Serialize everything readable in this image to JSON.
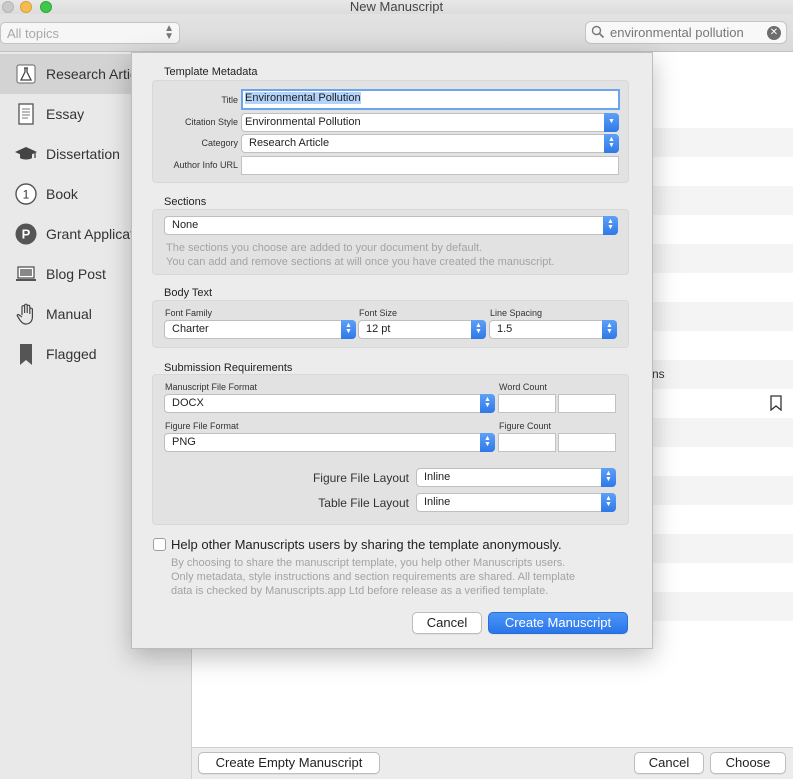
{
  "window": {
    "title": "New Manuscript"
  },
  "toolbar": {
    "topic_select": "All topics",
    "search_value": "environmental pollution"
  },
  "sidebar": {
    "items": [
      {
        "label": "Research Artic",
        "icon": "flask-icon",
        "selected": true
      },
      {
        "label": "Essay",
        "icon": "document-icon"
      },
      {
        "label": "Dissertation",
        "icon": "graduation-cap-icon"
      },
      {
        "label": "Book",
        "icon": "numbered-circle-icon",
        "icon_text": "1"
      },
      {
        "label": "Grant Applicat",
        "icon": "p-circle-icon",
        "icon_text": "P"
      },
      {
        "label": "Blog Post",
        "icon": "laptop-icon"
      },
      {
        "label": "Manual",
        "icon": "hand-icon"
      },
      {
        "label": "Flagged",
        "icon": "bookmark-icon"
      }
    ]
  },
  "main": {
    "partial_row_text": "ns"
  },
  "dialog": {
    "metadata": {
      "section_title": "Template Metadata",
      "title_label": "Title",
      "title_value": "Environmental Pollution",
      "citation_label": "Citation Style",
      "citation_value": "Environmental Pollution",
      "category_label": "Category",
      "category_value": "Research Article",
      "author_label": "Author Info URL",
      "author_value": ""
    },
    "sections": {
      "section_title": "Sections",
      "value": "None",
      "hint_line1": "The sections you choose are added to your document by default.",
      "hint_line2": "You can add and remove sections at will once you have created the manuscript."
    },
    "body_text": {
      "section_title": "Body Text",
      "font_family_label": "Font Family",
      "font_family_value": "Charter",
      "font_size_label": "Font Size",
      "font_size_value": "12 pt",
      "line_spacing_label": "Line Spacing",
      "line_spacing_value": "1.5"
    },
    "submission": {
      "section_title": "Submission Requirements",
      "manuscript_format_label": "Manuscript  File Format",
      "manuscript_format_value": "DOCX",
      "word_count_label": "Word Count",
      "figure_format_label": "Figure File Format",
      "figure_format_value": "PNG",
      "figure_count_label": "Figure Count",
      "figure_layout_label": "Figure File Layout",
      "figure_layout_value": "Inline",
      "table_layout_label": "Table File Layout",
      "table_layout_value": "Inline"
    },
    "share": {
      "checkbox_label": "Help other Manuscripts users by sharing the template anonymously.",
      "hint_line1": "By choosing to share the manuscript template, you help other Manuscripts users.",
      "hint_line2": "Only metadata, style instructions and section requirements are shared. All template",
      "hint_line3": "data is checked by Manuscripts.app Ltd before release as a verified template.",
      "checked": false
    },
    "buttons": {
      "cancel": "Cancel",
      "create": "Create Manuscript"
    }
  },
  "bottom": {
    "create_empty": "Create Empty Manuscript",
    "cancel": "Cancel",
    "choose": "Choose"
  }
}
